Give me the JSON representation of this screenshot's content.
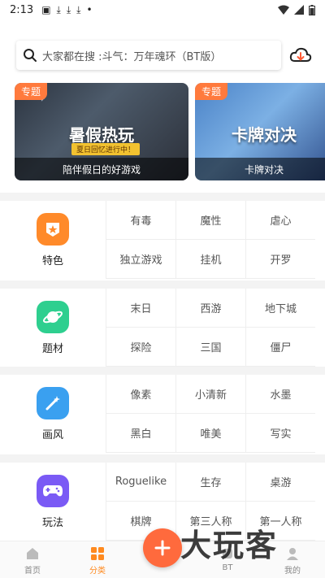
{
  "status": {
    "time": "2:13",
    "left_icons": [
      "image-icon",
      "download-icon",
      "download-icon",
      "download-icon",
      "dot-icon"
    ],
    "right_icons": [
      "wifi-icon",
      "signal-icon",
      "battery-icon"
    ]
  },
  "search": {
    "placeholder": "大家都在搜 :斗气：万年魂环（BT版）"
  },
  "banners": [
    {
      "tag": "专题",
      "headline": "暑假热玩",
      "sub": "夏日回忆进行中！",
      "caption": "陪伴假日的好游戏"
    },
    {
      "tag": "专题",
      "headline": "卡牌对决",
      "caption": "卡牌对决"
    }
  ],
  "categories": [
    {
      "label": "特色",
      "color": "#ff8a2a",
      "icon": "star-badge-icon",
      "items": [
        "有毒",
        "魔性",
        "虐心",
        "独立游戏",
        "挂机",
        "开罗"
      ]
    },
    {
      "label": "题材",
      "color": "#2ecf8f",
      "icon": "planet-icon",
      "items": [
        "末日",
        "西游",
        "地下城",
        "探险",
        "三国",
        "僵尸"
      ]
    },
    {
      "label": "画风",
      "color": "#3aa0f0",
      "icon": "magic-wand-icon",
      "items": [
        "像素",
        "小清新",
        "水墨",
        "黑白",
        "唯美",
        "写实"
      ]
    },
    {
      "label": "玩法",
      "color": "#7a5af5",
      "icon": "gamepad-icon",
      "items": [
        "Roguelike",
        "生存",
        "桌游",
        "棋牌",
        "第三人称",
        "第一人称"
      ]
    }
  ],
  "nav": [
    {
      "label": "首页",
      "icon": "home-icon",
      "active": false
    },
    {
      "label": "分类",
      "icon": "grid-icon",
      "active": true
    },
    {
      "label": "BT",
      "icon": "bt-icon",
      "active": false
    },
    {
      "label": "我的",
      "icon": "user-icon",
      "active": false
    }
  ],
  "watermark": "大玩客"
}
